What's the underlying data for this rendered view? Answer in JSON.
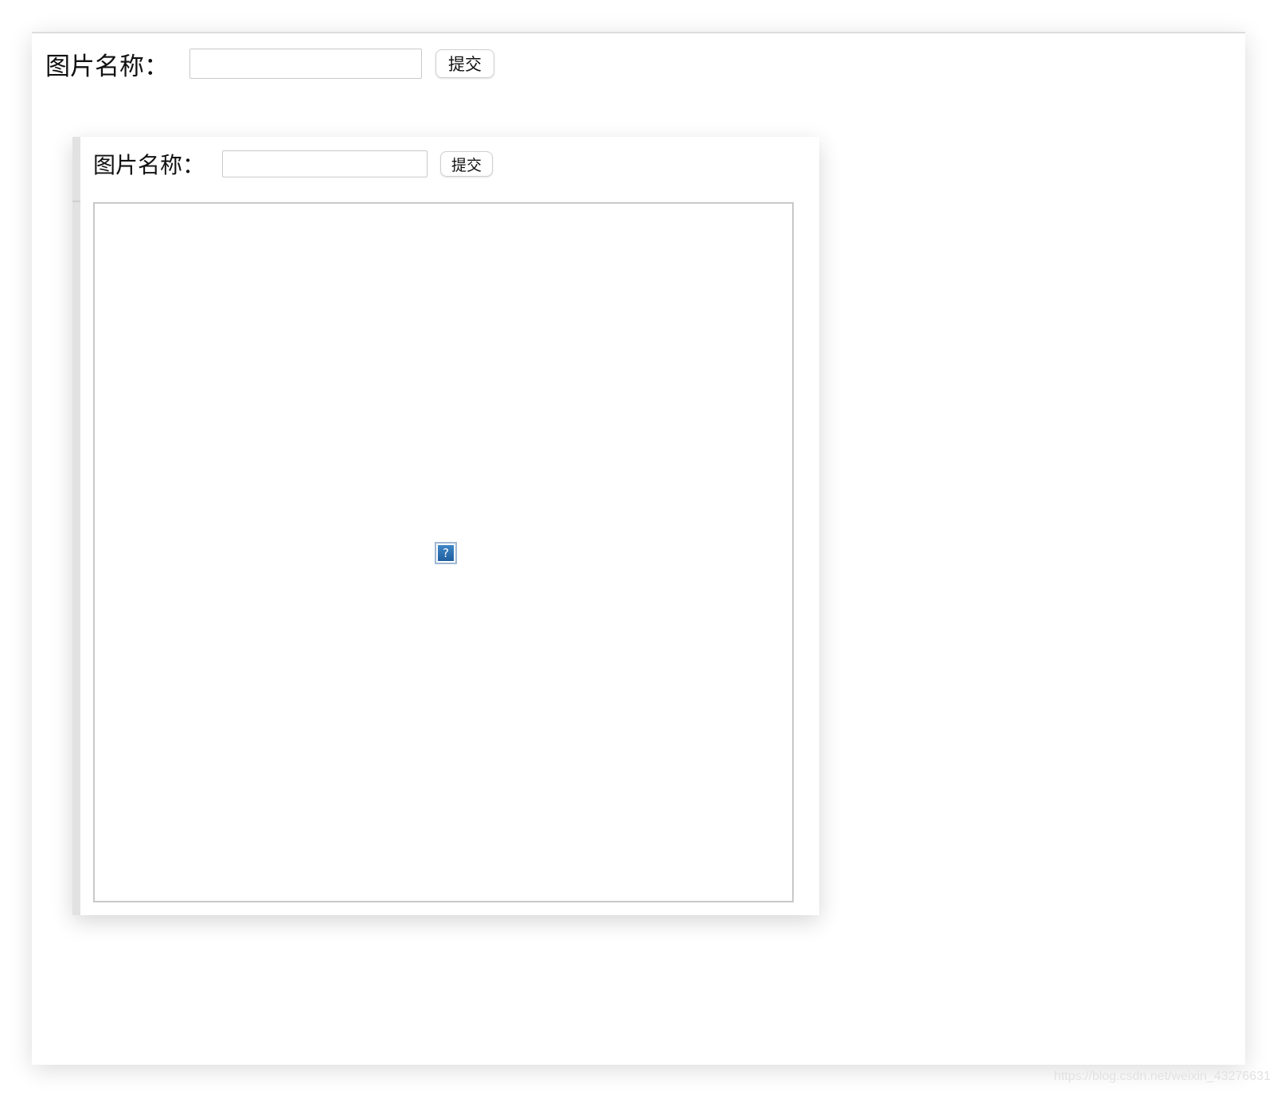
{
  "outer_form": {
    "label": "图片名称：",
    "input_value": "",
    "submit_label": "提交"
  },
  "inner_frame": {
    "form": {
      "label": "图片名称：",
      "input_value": "",
      "submit_label": "提交"
    },
    "image": {
      "broken_icon_glyph": "?",
      "icon": "broken-image-icon"
    }
  },
  "watermark": "https://blog.csdn.net/weixin_43276631",
  "colors": {
    "icon_blue": "#2f73b5",
    "border_gray": "#c8c8c8"
  }
}
